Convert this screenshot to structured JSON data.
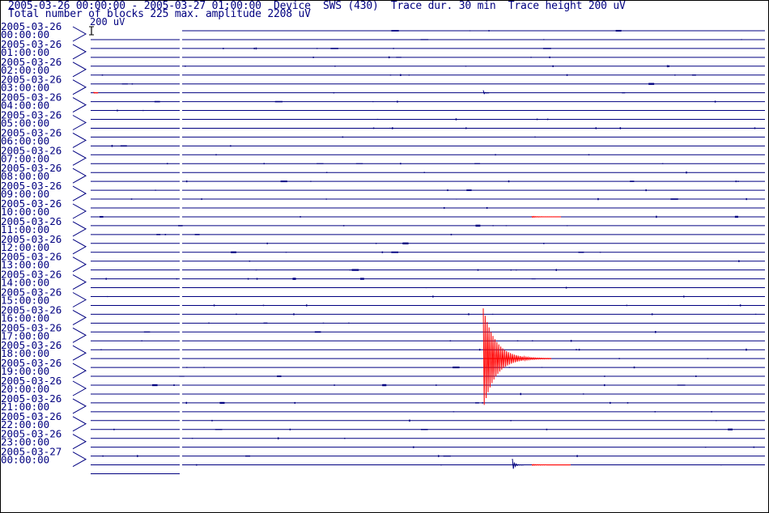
{
  "header": {
    "line1": "2005-03-26 00:00:00 - 2005-03-27 01:00:00  Device  SWS (430)  Trace dur. 30 min  Trace height 200 uV",
    "line2": "Total number of blocks 225 max. amplitude 2208 uV"
  },
  "scale_label": "200 uV",
  "colors": {
    "trace": "#000080",
    "event": "#ff0000",
    "text": "#000080",
    "frame": "#000000"
  },
  "chart_data": {
    "type": "helicorder",
    "trace_duration_min": 30,
    "trace_height_uV": 200,
    "max_amplitude_uV": 2208,
    "total_blocks": 225,
    "rows": [
      {
        "date": "2005-03-26",
        "time": "00:00:00"
      },
      {
        "date": "2005-03-26",
        "time": "01:00:00"
      },
      {
        "date": "2005-03-26",
        "time": "02:00:00"
      },
      {
        "date": "2005-03-26",
        "time": "03:00:00"
      },
      {
        "date": "2005-03-26",
        "time": "04:00:00"
      },
      {
        "date": "2005-03-26",
        "time": "05:00:00"
      },
      {
        "date": "2005-03-26",
        "time": "06:00:00"
      },
      {
        "date": "2005-03-26",
        "time": "07:00:00"
      },
      {
        "date": "2005-03-26",
        "time": "08:00:00"
      },
      {
        "date": "2005-03-26",
        "time": "09:00:00"
      },
      {
        "date": "2005-03-26",
        "time": "10:00:00"
      },
      {
        "date": "2005-03-26",
        "time": "11:00:00"
      },
      {
        "date": "2005-03-26",
        "time": "12:00:00"
      },
      {
        "date": "2005-03-26",
        "time": "13:00:00"
      },
      {
        "date": "2005-03-26",
        "time": "14:00:00"
      },
      {
        "date": "2005-03-26",
        "time": "15:00:00"
      },
      {
        "date": "2005-03-26",
        "time": "16:00:00"
      },
      {
        "date": "2005-03-26",
        "time": "17:00:00"
      },
      {
        "date": "2005-03-26",
        "time": "18:00:00"
      },
      {
        "date": "2005-03-26",
        "time": "19:00:00"
      },
      {
        "date": "2005-03-26",
        "time": "20:00:00"
      },
      {
        "date": "2005-03-26",
        "time": "21:00:00"
      },
      {
        "date": "2005-03-26",
        "time": "22:00:00"
      },
      {
        "date": "2005-03-26",
        "time": "23:00:00"
      },
      {
        "date": "2005-03-27",
        "time": "00:00:00"
      }
    ],
    "events": [
      {
        "time": "2005-03-26 18:00",
        "offset_min": 15.5,
        "peak_uV": 2208,
        "duration_min": 3.5,
        "color": "red"
      },
      {
        "time": "2005-03-26 03:00",
        "offset_min": 1.0,
        "peak_uV": 20,
        "duration_min": 1.5,
        "color": "red"
      },
      {
        "time": "2005-03-26 10:00",
        "offset_min": 48.0,
        "peak_uV": 15,
        "duration_min": 1.5,
        "color": "red"
      },
      {
        "time": "2005-03-27 00:00",
        "offset_min": 48.0,
        "peak_uV": 15,
        "duration_min": 2.0,
        "color": "red"
      },
      {
        "time": "2005-03-27 00:00",
        "offset_min": 17.0,
        "peak_uV": 150,
        "duration_min": 0.6,
        "color": "blue"
      },
      {
        "time": "2005-03-26 03:00",
        "offset_min": 15.5,
        "peak_uV": 60,
        "duration_min": 0.3,
        "color": "blue"
      }
    ]
  }
}
